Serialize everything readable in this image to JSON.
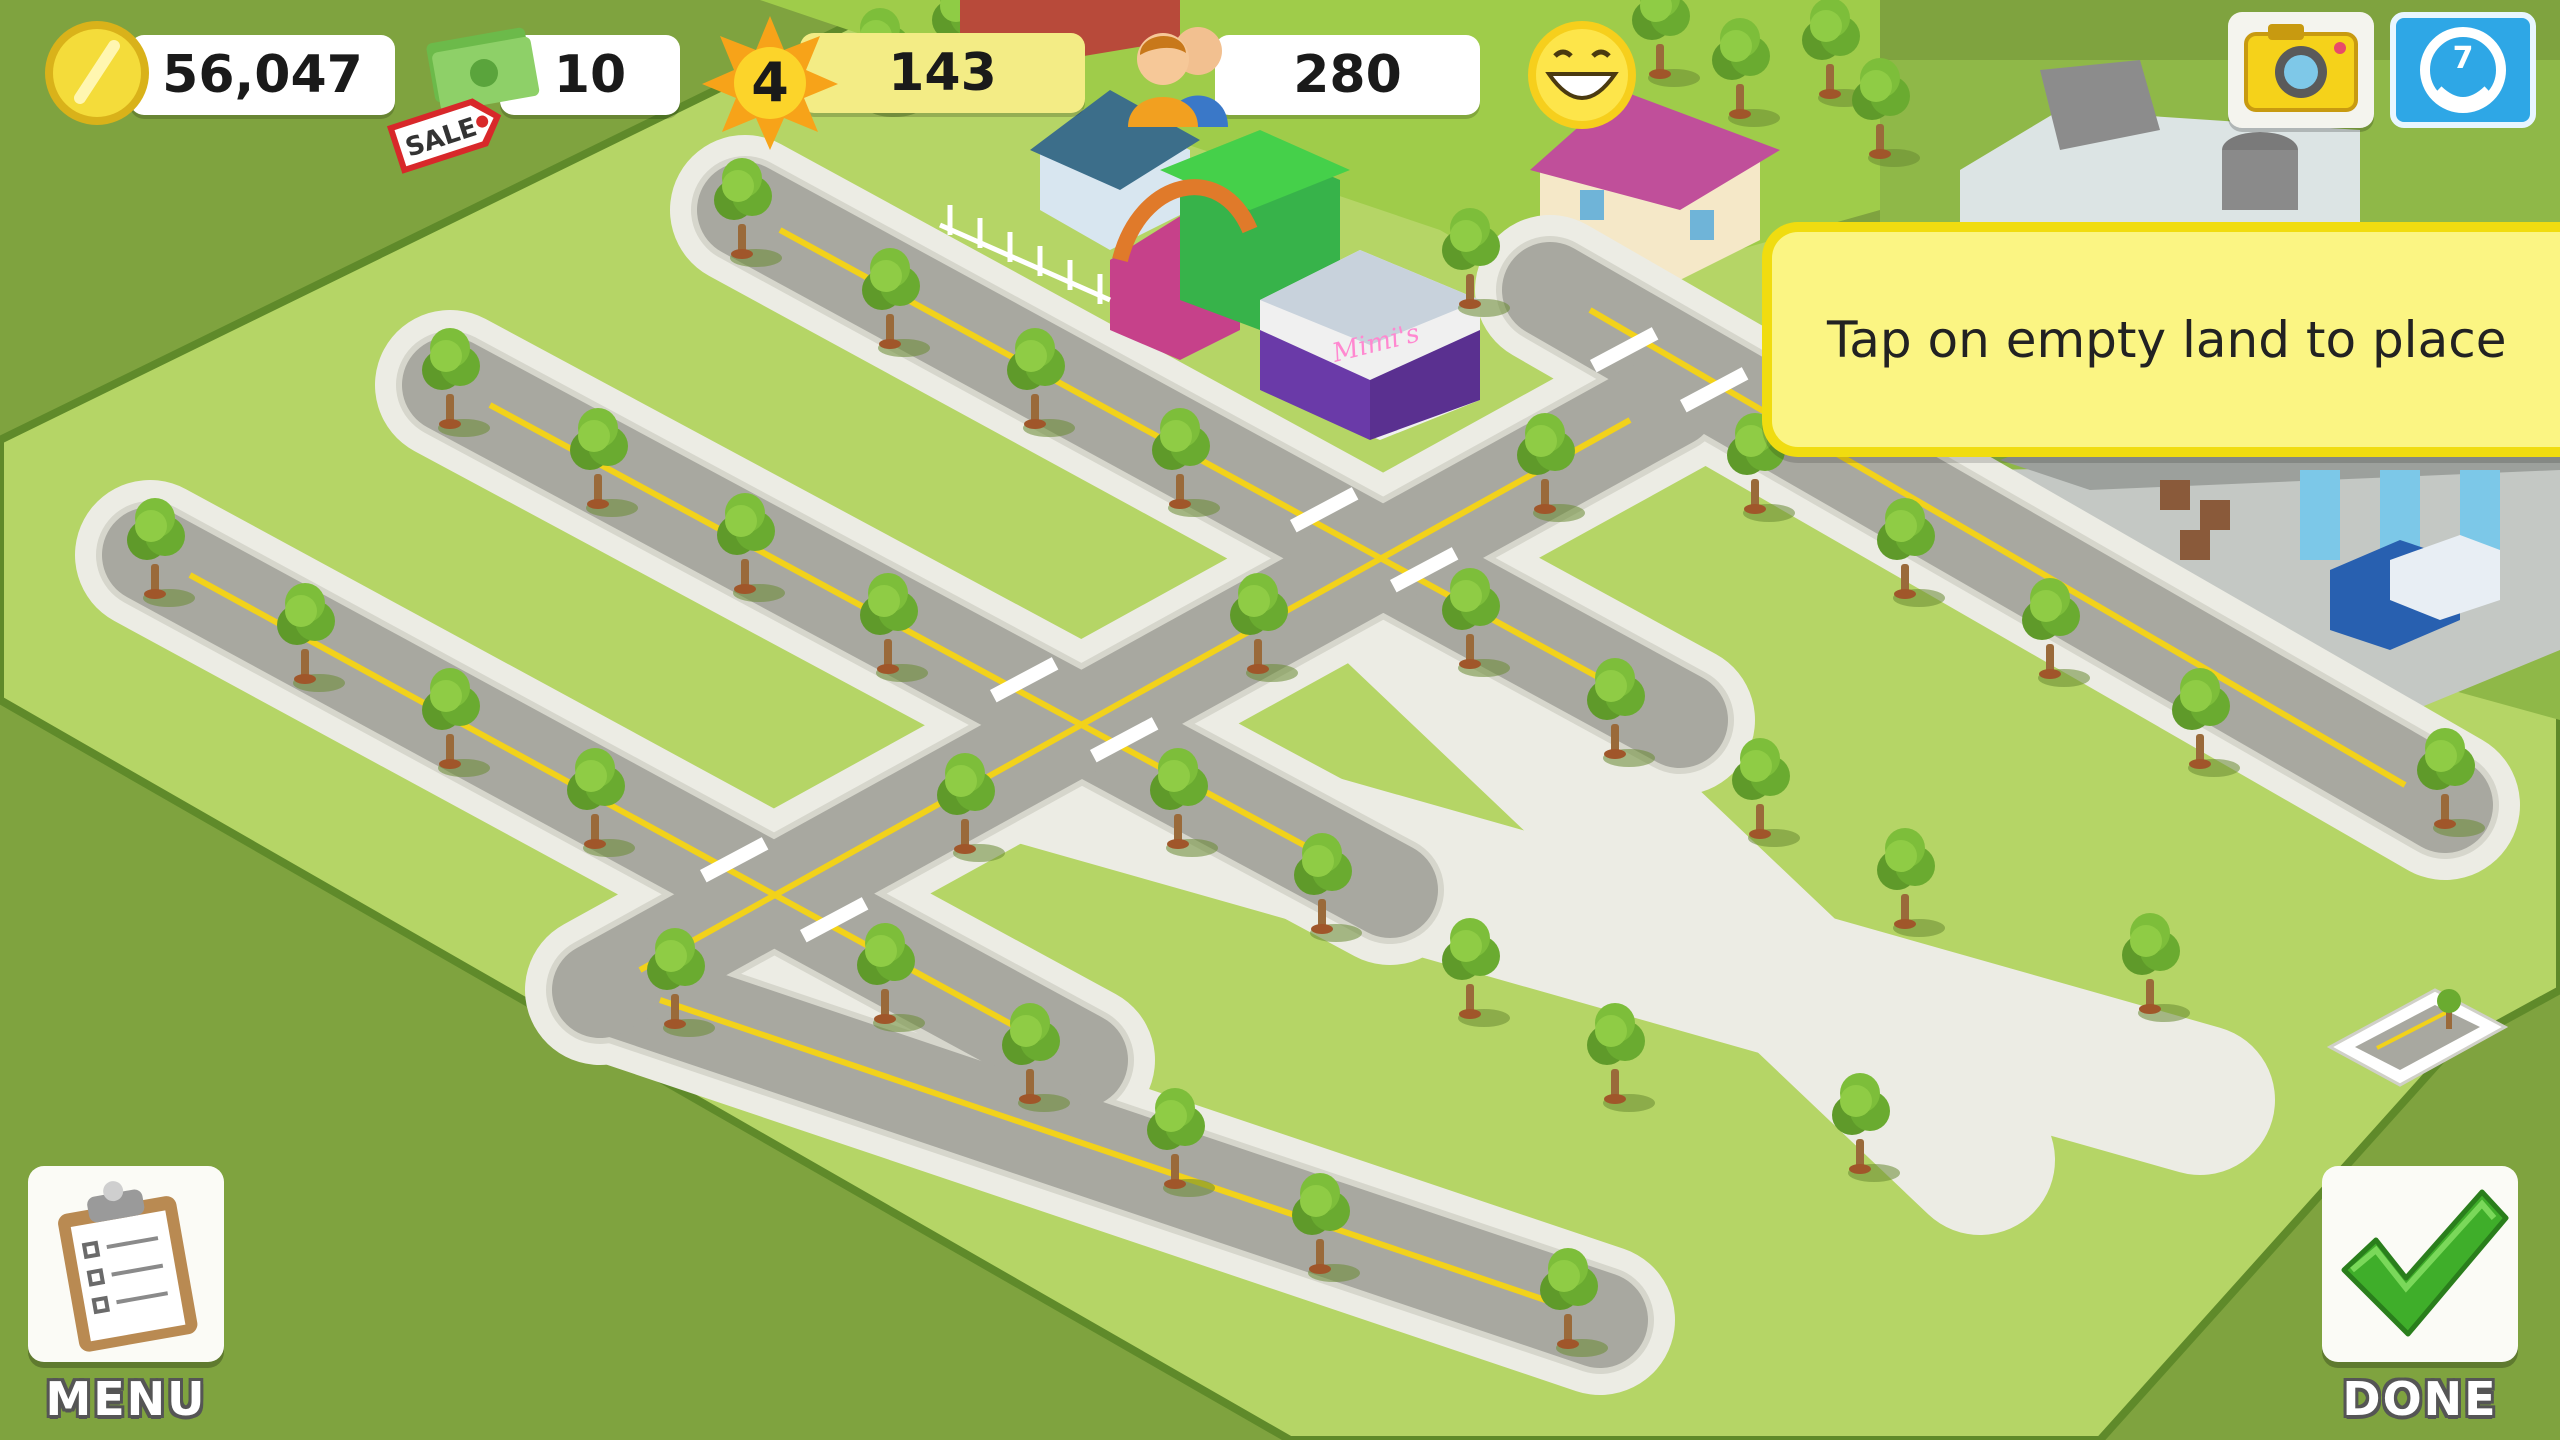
{
  "hud": {
    "coins": "56,047",
    "cash": "10",
    "sale_badge": "SALE",
    "level": "4",
    "xp": "143",
    "population": "280"
  },
  "city": {
    "shop_sign": "Mimi's"
  },
  "tooltip": {
    "text": "Tap on empty land to place"
  },
  "buttons": {
    "menu_label": "MENU",
    "done_label": "DONE",
    "camera": "camera-icon",
    "social": "social-icon",
    "road_preview": "road-piece-icon"
  },
  "colors": {
    "grass_lot": "#b5d566",
    "grass_outer": "#7fa33f",
    "road": "#a8a8a0",
    "road_line": "#f2d21a",
    "sidewalk": "#ecece4",
    "tooltip_bg": "#fbf583",
    "done_check": "#3fae2a"
  }
}
